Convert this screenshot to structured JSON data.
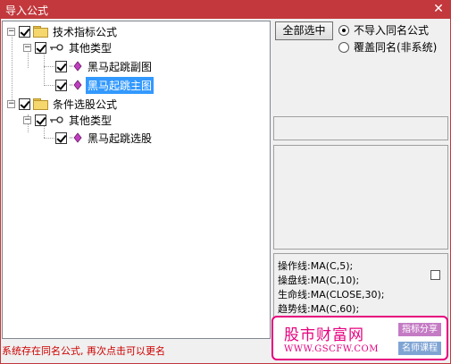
{
  "window": {
    "title": "导入公式",
    "close_glyph": "✕"
  },
  "tree": {
    "nodes": [
      {
        "label": "技术指标公式",
        "expander": "−",
        "checked": true,
        "icon": "folder-icon"
      },
      {
        "label": "其他类型",
        "expander": "−",
        "checked": true,
        "icon": "key-icon"
      },
      {
        "label": "黑马起跳副图",
        "checked": true,
        "icon": "formula-gem-icon"
      },
      {
        "label": "黑马起跳主图",
        "checked": true,
        "icon": "formula-gem-icon",
        "selected": true
      },
      {
        "label": "条件选股公式",
        "expander": "−",
        "checked": true,
        "icon": "folder-icon"
      },
      {
        "label": "其他类型",
        "expander": "−",
        "checked": true,
        "icon": "key-icon"
      },
      {
        "label": "黑马起跳选股",
        "checked": true,
        "icon": "formula-gem-icon"
      }
    ]
  },
  "options": {
    "select_all_label": "全部选中",
    "radio_no_import": "不导入同名公式",
    "radio_overwrite": "覆盖同名(非系统)",
    "selected": "no_import"
  },
  "code_preview": {
    "lines": [
      "操作线:MA(C,5);",
      "操盘线:MA(C,10);",
      "生命线:MA(CLOSE,30);",
      "趋势线:MA(C,60);"
    ]
  },
  "status": "系统存在同名公式, 再次点击可以更名",
  "watermark": {
    "brand": "股市财富网",
    "url": "WWW.GSCFW.COM",
    "tag1": "指标分享",
    "tag2": "名师课程",
    "color": "#e6007e"
  },
  "colors": {
    "titlebar": "#c2383c",
    "selection": "#3399ff",
    "status": "#cc0000"
  }
}
